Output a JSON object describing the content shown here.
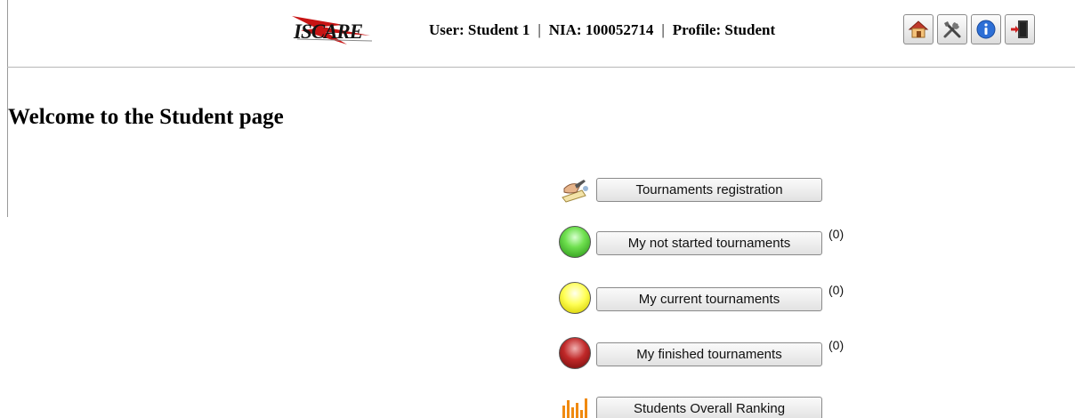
{
  "header": {
    "logo_text": "ISCARE",
    "user_label": "User: Student 1",
    "nia_label": "NIA: 100052714",
    "profile_label": "Profile: Student",
    "separator": "|",
    "toolbar": [
      {
        "name": "home-button",
        "icon": "house-icon"
      },
      {
        "name": "tools-button",
        "icon": "tools-icon"
      },
      {
        "name": "info-button",
        "icon": "info-icon"
      },
      {
        "name": "logout-button",
        "icon": "exit-door-icon"
      }
    ]
  },
  "page": {
    "title": "Welcome to the Student page"
  },
  "menu": {
    "items": [
      {
        "label": "Tournaments registration",
        "count": "",
        "icon": "writing-hand-icon"
      },
      {
        "label": "My not started tournaments",
        "count": "(0)",
        "icon": "green-orb-icon"
      },
      {
        "label": "My current tournaments",
        "count": "(0)",
        "icon": "yellow-orb-icon"
      },
      {
        "label": "My finished tournaments",
        "count": "(0)",
        "icon": "red-orb-icon"
      },
      {
        "label": "Students Overall Ranking",
        "count": "",
        "icon": "bar-chart-icon"
      }
    ]
  },
  "colors": {
    "green_orb": "#4fc934",
    "yellow_orb": "#f2f224",
    "red_orb": "#a01c1c",
    "ranking_bars": "#f08a10",
    "info_blue": "#2d6fd6",
    "logout_red": "#d02020"
  }
}
